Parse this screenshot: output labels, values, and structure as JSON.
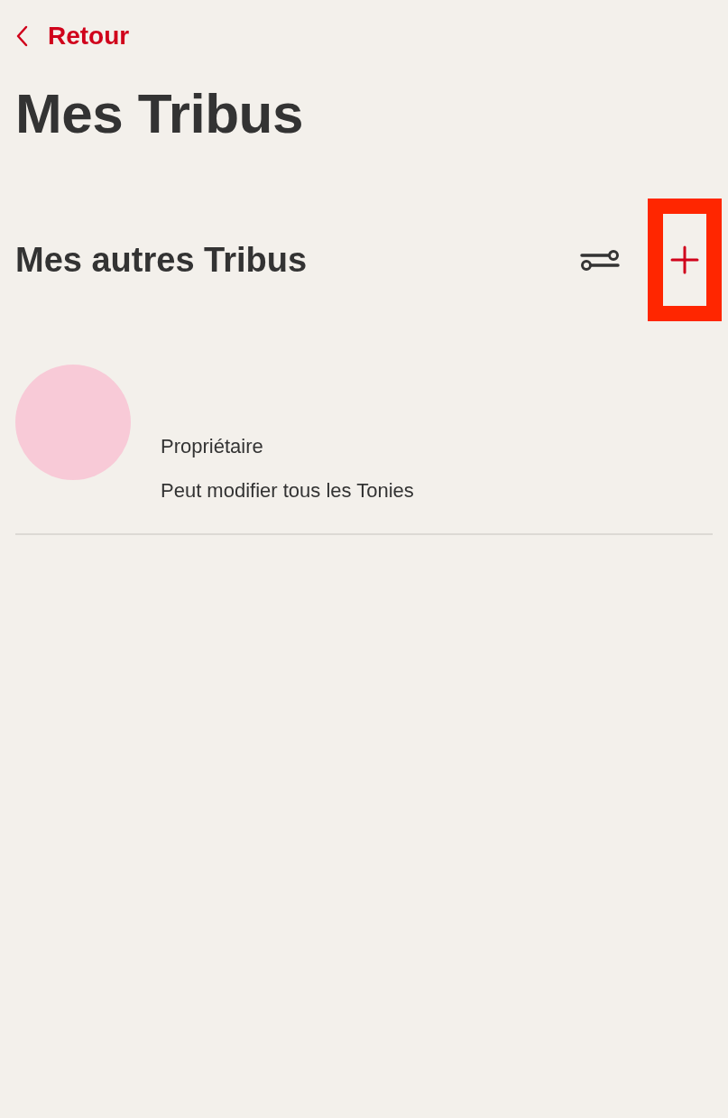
{
  "back": {
    "label": "Retour"
  },
  "title": "Mes Tribus",
  "section": {
    "title": "Mes autres Tribus",
    "add_highlighted": true
  },
  "tribes": [
    {
      "color": "#f8cad7",
      "role": "Propriétaire",
      "permission": "Peut modifier tous les Tonies"
    }
  ]
}
